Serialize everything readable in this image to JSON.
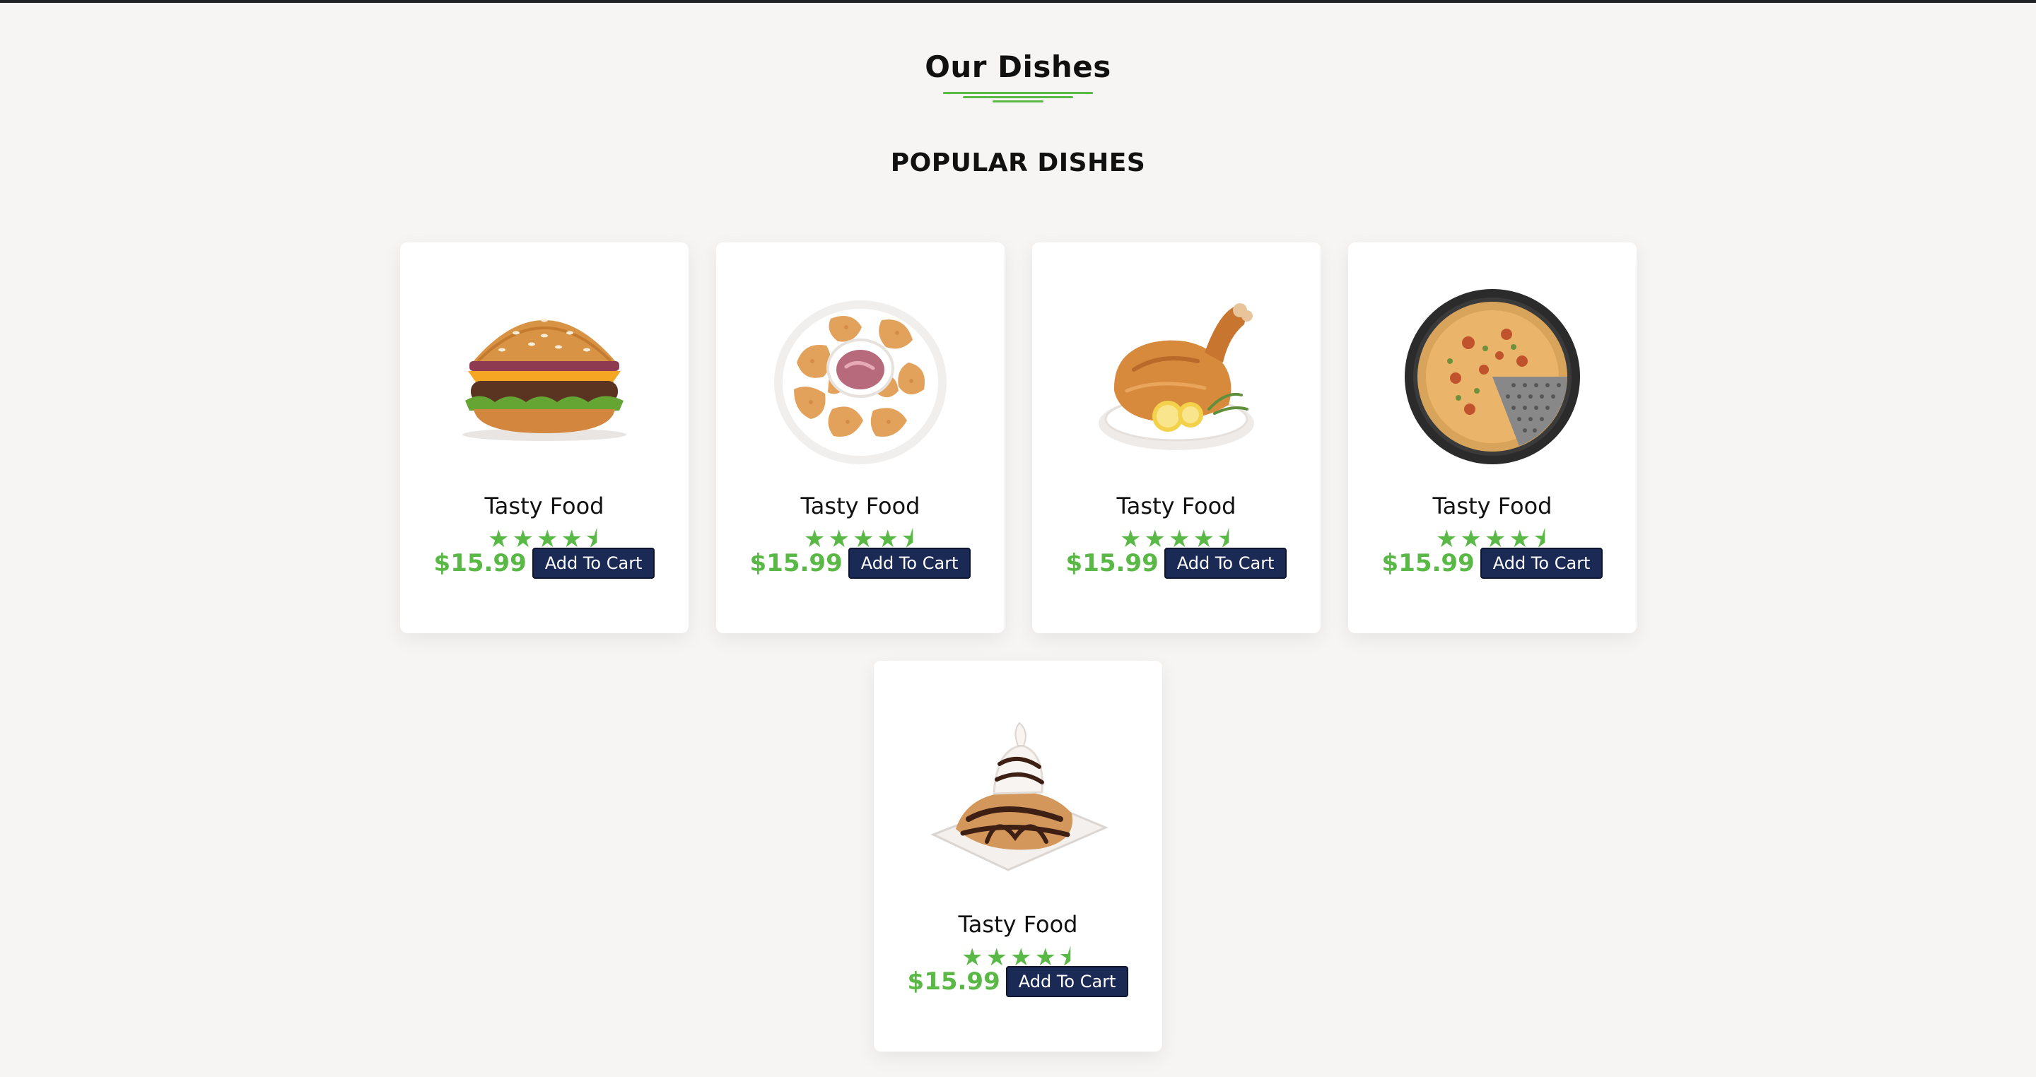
{
  "section": {
    "title": "Our Dishes",
    "subtitle": "POPULAR DISHES"
  },
  "dishes": [
    {
      "image_icon": "burger-icon",
      "name": "Tasty Food",
      "rating": 4.5,
      "stars_text": "★★★★⯨",
      "price": "$15.99",
      "cart_label": "Add To Cart"
    },
    {
      "image_icon": "nuggets-icon",
      "name": "Tasty Food",
      "rating": 4.5,
      "stars_text": "★★★★⯨",
      "price": "$15.99",
      "cart_label": "Add To Cart"
    },
    {
      "image_icon": "roast-chicken-icon",
      "name": "Tasty Food",
      "rating": 4.5,
      "stars_text": "★★★★⯨",
      "price": "$15.99",
      "cart_label": "Add To Cart"
    },
    {
      "image_icon": "pizza-icon",
      "name": "Tasty Food",
      "rating": 4.5,
      "stars_text": "★★★★⯨",
      "price": "$15.99",
      "cart_label": "Add To Cart"
    },
    {
      "image_icon": "dessert-icon",
      "name": "Tasty Food",
      "rating": 4.5,
      "stars_text": "★★★★⯨",
      "price": "$15.99",
      "cart_label": "Add To Cart"
    }
  ],
  "colors": {
    "accent": "#5ab946",
    "button": "#1b2a55",
    "background": "#f7f5f4",
    "card": "#ffffff"
  }
}
